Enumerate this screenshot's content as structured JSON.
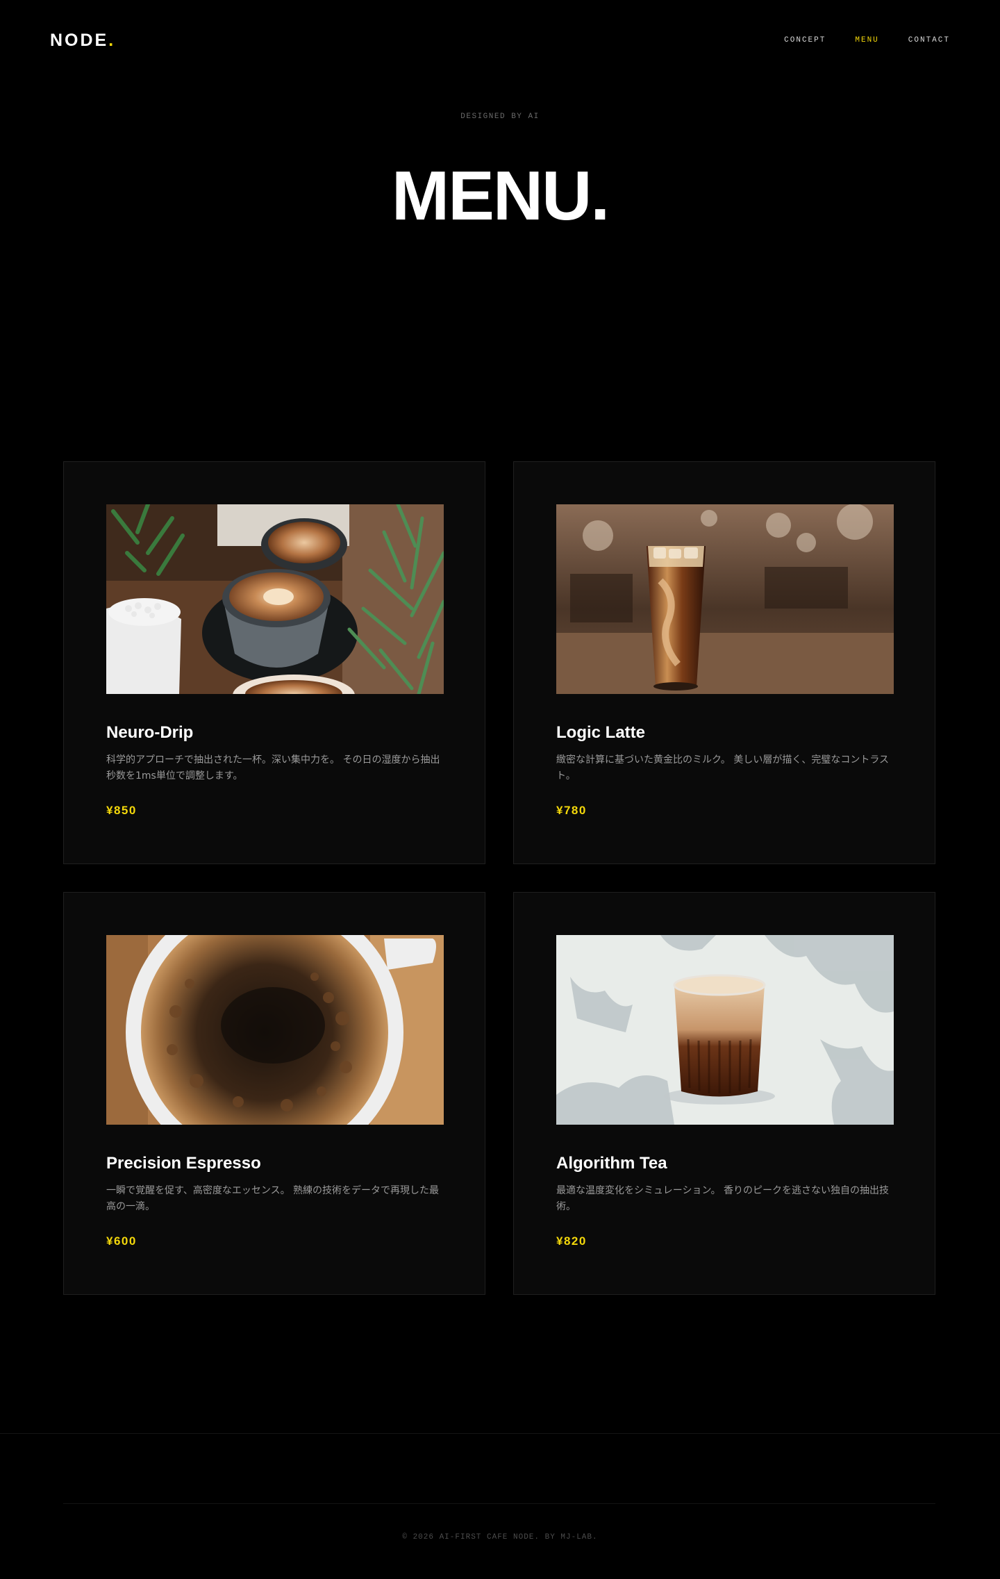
{
  "header": {
    "logo_text": "NODE",
    "logo_dot": ".",
    "nav": [
      {
        "label": "CONCEPT",
        "active": false
      },
      {
        "label": "MENU",
        "active": true
      },
      {
        "label": "CONTACT",
        "active": false
      }
    ]
  },
  "hero": {
    "subtitle": "DESIGNED BY AI",
    "title": "MENU."
  },
  "menu_items": [
    {
      "name": "Neuro-Drip",
      "description": "科学的アプローチで抽出された一杯。深い集中力を。 その日の湿度から抽出秒数を1ms単位で調整します。",
      "price": "¥850",
      "image": "latte-art-cups-with-plants"
    },
    {
      "name": "Logic Latte",
      "description": "緻密な計算に基づいた黄金比のミルク。 美しい層が描く、完璧なコントラスト。",
      "price": "¥780",
      "image": "iced-latte-glass"
    },
    {
      "name": "Precision Espresso",
      "description": "一瞬で覚醒を促す、高密度なエッセンス。 熟練の技術をデータで再現した最高の一滴。",
      "price": "¥600",
      "image": "espresso-crema-cup"
    },
    {
      "name": "Algorithm Tea",
      "description": "最適な温度変化をシミュレーション。 香りのピークを逃さない独自の抽出技術。",
      "price": "¥820",
      "image": "glass-of-tea-in-sunlight"
    }
  ],
  "footer": {
    "copyright": "© 2026 AI-FIRST CAFE NODE. BY MJ-LAB."
  },
  "colors": {
    "background": "#000000",
    "card": "#0a0a0a",
    "accent": "#f5d90a"
  }
}
